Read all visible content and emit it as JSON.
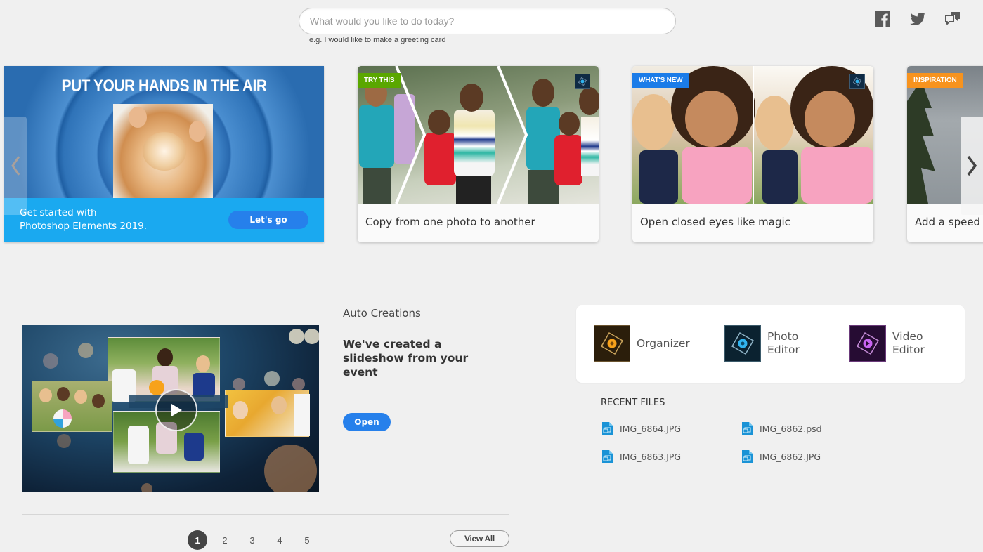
{
  "search": {
    "placeholder": "What would you like to do today?",
    "hint": "e.g. I would like to make a greeting card"
  },
  "social": [
    {
      "icon": "facebook-icon",
      "label": "Facebook"
    },
    {
      "icon": "twitter-icon",
      "label": "Twitter"
    },
    {
      "icon": "feedback-icon",
      "label": "Feedback"
    }
  ],
  "carousel": {
    "hero": {
      "title": "PUT YOUR HANDS IN THE AIR",
      "text_line1": "Get started with",
      "text_line2": "Photoshop Elements 2019.",
      "cta": "Let's go"
    },
    "cards": [
      {
        "badge": "TRY THIS",
        "badge_color": "#5aa700",
        "caption": "Copy from one photo to another",
        "app_icon": "photo-editor-icon"
      },
      {
        "badge": "WHAT'S NEW",
        "badge_color": "#1b7ce8",
        "caption": "Open closed eyes like magic",
        "app_icon": "photo-editor-icon"
      },
      {
        "badge": "INSPIRATION",
        "badge_color": "#f7931e",
        "caption": "Add a speed",
        "app_icon": ""
      }
    ],
    "prev_icon": "chevron-left-icon",
    "next_icon": "chevron-right-icon"
  },
  "auto_creations": {
    "label": "Auto Creations",
    "title": "We've created a slideshow from your event",
    "open_label": "Open",
    "pages": [
      "1",
      "2",
      "3",
      "4",
      "5"
    ],
    "active_page": "1",
    "view_all": "View All"
  },
  "apps": [
    {
      "label_line1": "Organizer",
      "label_line2": "",
      "color": "#f7a21b",
      "bg": "#2b1e0b"
    },
    {
      "label_line1": "Photo",
      "label_line2": "Editor",
      "color": "#31b4ef",
      "bg": "#0b2230"
    },
    {
      "label_line1": "Video",
      "label_line2": "Editor",
      "color": "#c964f2",
      "bg": "#260c33"
    }
  ],
  "recent_files": {
    "title": "RECENT FILES",
    "files": [
      {
        "name": "IMG_6864.JPG"
      },
      {
        "name": "IMG_6862.psd"
      },
      {
        "name": "IMG_6863.JPG"
      },
      {
        "name": "IMG_6862.JPG"
      }
    ]
  },
  "colors": {
    "accent": "#2680eb",
    "background": "#f0f0f0",
    "hero_band": "#1aa9f0"
  }
}
